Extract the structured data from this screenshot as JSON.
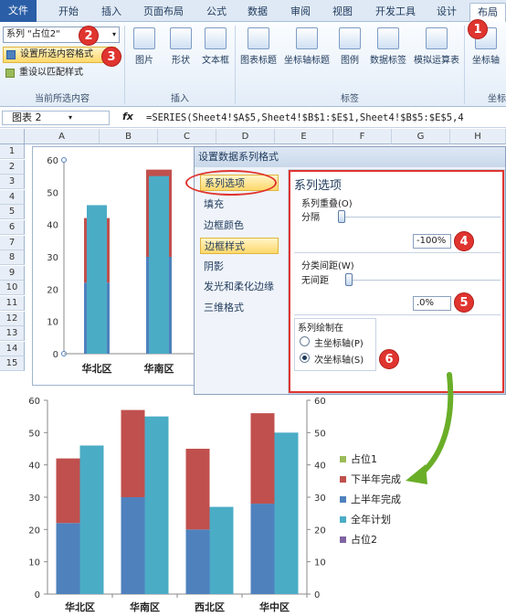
{
  "ribbon": {
    "tabs": [
      "文件",
      "开始",
      "插入",
      "页面布局",
      "公式",
      "数据",
      "审阅",
      "视图",
      "开发工具",
      "设计",
      "布局"
    ],
    "series_selector": "系列 \"占位2\"",
    "format_selection": "设置所选内容格式",
    "reset_style": "重设以匹配样式",
    "group_current": "当前所选内容",
    "group_insert": "插入",
    "group_labels": "标签",
    "group_axis": "坐标",
    "buttons": {
      "picture": "图片",
      "shapes": "形状",
      "textbox": "文本框",
      "chart_title": "图表标题",
      "axis_title": "坐标轴标题",
      "legend": "图例",
      "data_labels": "数据标签",
      "data_table": "模拟运算表",
      "axes": "坐标轴"
    }
  },
  "formula_bar": {
    "name_box": "图表 2",
    "fx": "fx",
    "formula": "=SERIES(Sheet4!$A$5,Sheet4!$B$1:$E$1,Sheet4!$B$5:$E$5,4"
  },
  "sheet": {
    "columns": [
      "A",
      "B",
      "C",
      "D",
      "E",
      "F",
      "G",
      "H"
    ],
    "rows": [
      "1",
      "2",
      "3",
      "4",
      "5",
      "6",
      "7",
      "8",
      "9",
      "10",
      "11",
      "12",
      "13",
      "14",
      "15"
    ]
  },
  "dialog": {
    "title": "设置数据系列格式",
    "nav": [
      "系列选项",
      "填充",
      "边框颜色",
      "边框样式",
      "阴影",
      "发光和柔化边缘",
      "三维格式"
    ],
    "selected_nav": "边框样式",
    "section_title": "系列选项",
    "overlap_label": "系列重叠(O)",
    "overlap_left": "分隔",
    "overlap_value": "-100%",
    "gap_label": "分类间距(W)",
    "gap_left": "无间距",
    "gap_value": ".0%",
    "plot_on_label": "系列绘制在",
    "primary_axis": "主坐标轴(P)",
    "secondary_axis": "次坐标轴(S)",
    "selected_axis": "secondary"
  },
  "badges": [
    "1",
    "2",
    "3",
    "4",
    "5",
    "6"
  ],
  "colors": {
    "first_half": "#4f81bd",
    "second_half": "#c0504d",
    "annual_plan": "#4bacc6",
    "placeholder1": "#9bbb59",
    "placeholder2": "#8064a2",
    "badge": "#e0342f",
    "arrow": "#6aae28"
  },
  "chart_data": [
    {
      "type": "bar",
      "categories": [
        "华北区",
        "华南区"
      ],
      "series": [
        {
          "name": "上半年完成",
          "values": [
            22,
            30
          ]
        },
        {
          "name": "下半年完成",
          "values": [
            20,
            27
          ]
        },
        {
          "name": "全年计划",
          "values": [
            46,
            55
          ]
        }
      ],
      "ylim": [
        0,
        60
      ],
      "yticks": [
        "0",
        "10",
        "20",
        "30",
        "40",
        "50",
        "60"
      ]
    },
    {
      "type": "bar",
      "categories": [
        "华北区",
        "华南区",
        "西北区",
        "华中区"
      ],
      "series": [
        {
          "name": "占位1",
          "values": [
            0,
            0,
            0,
            0
          ]
        },
        {
          "name": "下半年完成",
          "values": [
            20,
            27,
            25,
            28
          ]
        },
        {
          "name": "上半年完成",
          "values": [
            22,
            30,
            20,
            28
          ]
        },
        {
          "name": "全年计划",
          "values": [
            46,
            55,
            27,
            50
          ]
        },
        {
          "name": "占位2",
          "values": [
            0,
            0,
            0,
            0
          ]
        }
      ],
      "ylim": [
        0,
        60
      ],
      "yticks_left": [
        "0",
        "10",
        "20",
        "30",
        "40",
        "50",
        "60"
      ],
      "yticks_right": [
        "0",
        "10",
        "20",
        "30",
        "40",
        "50",
        "60"
      ],
      "legend": [
        "占位1",
        "下半年完成",
        "上半年完成",
        "全年计划",
        "占位2"
      ],
      "legend_position": "right"
    }
  ]
}
